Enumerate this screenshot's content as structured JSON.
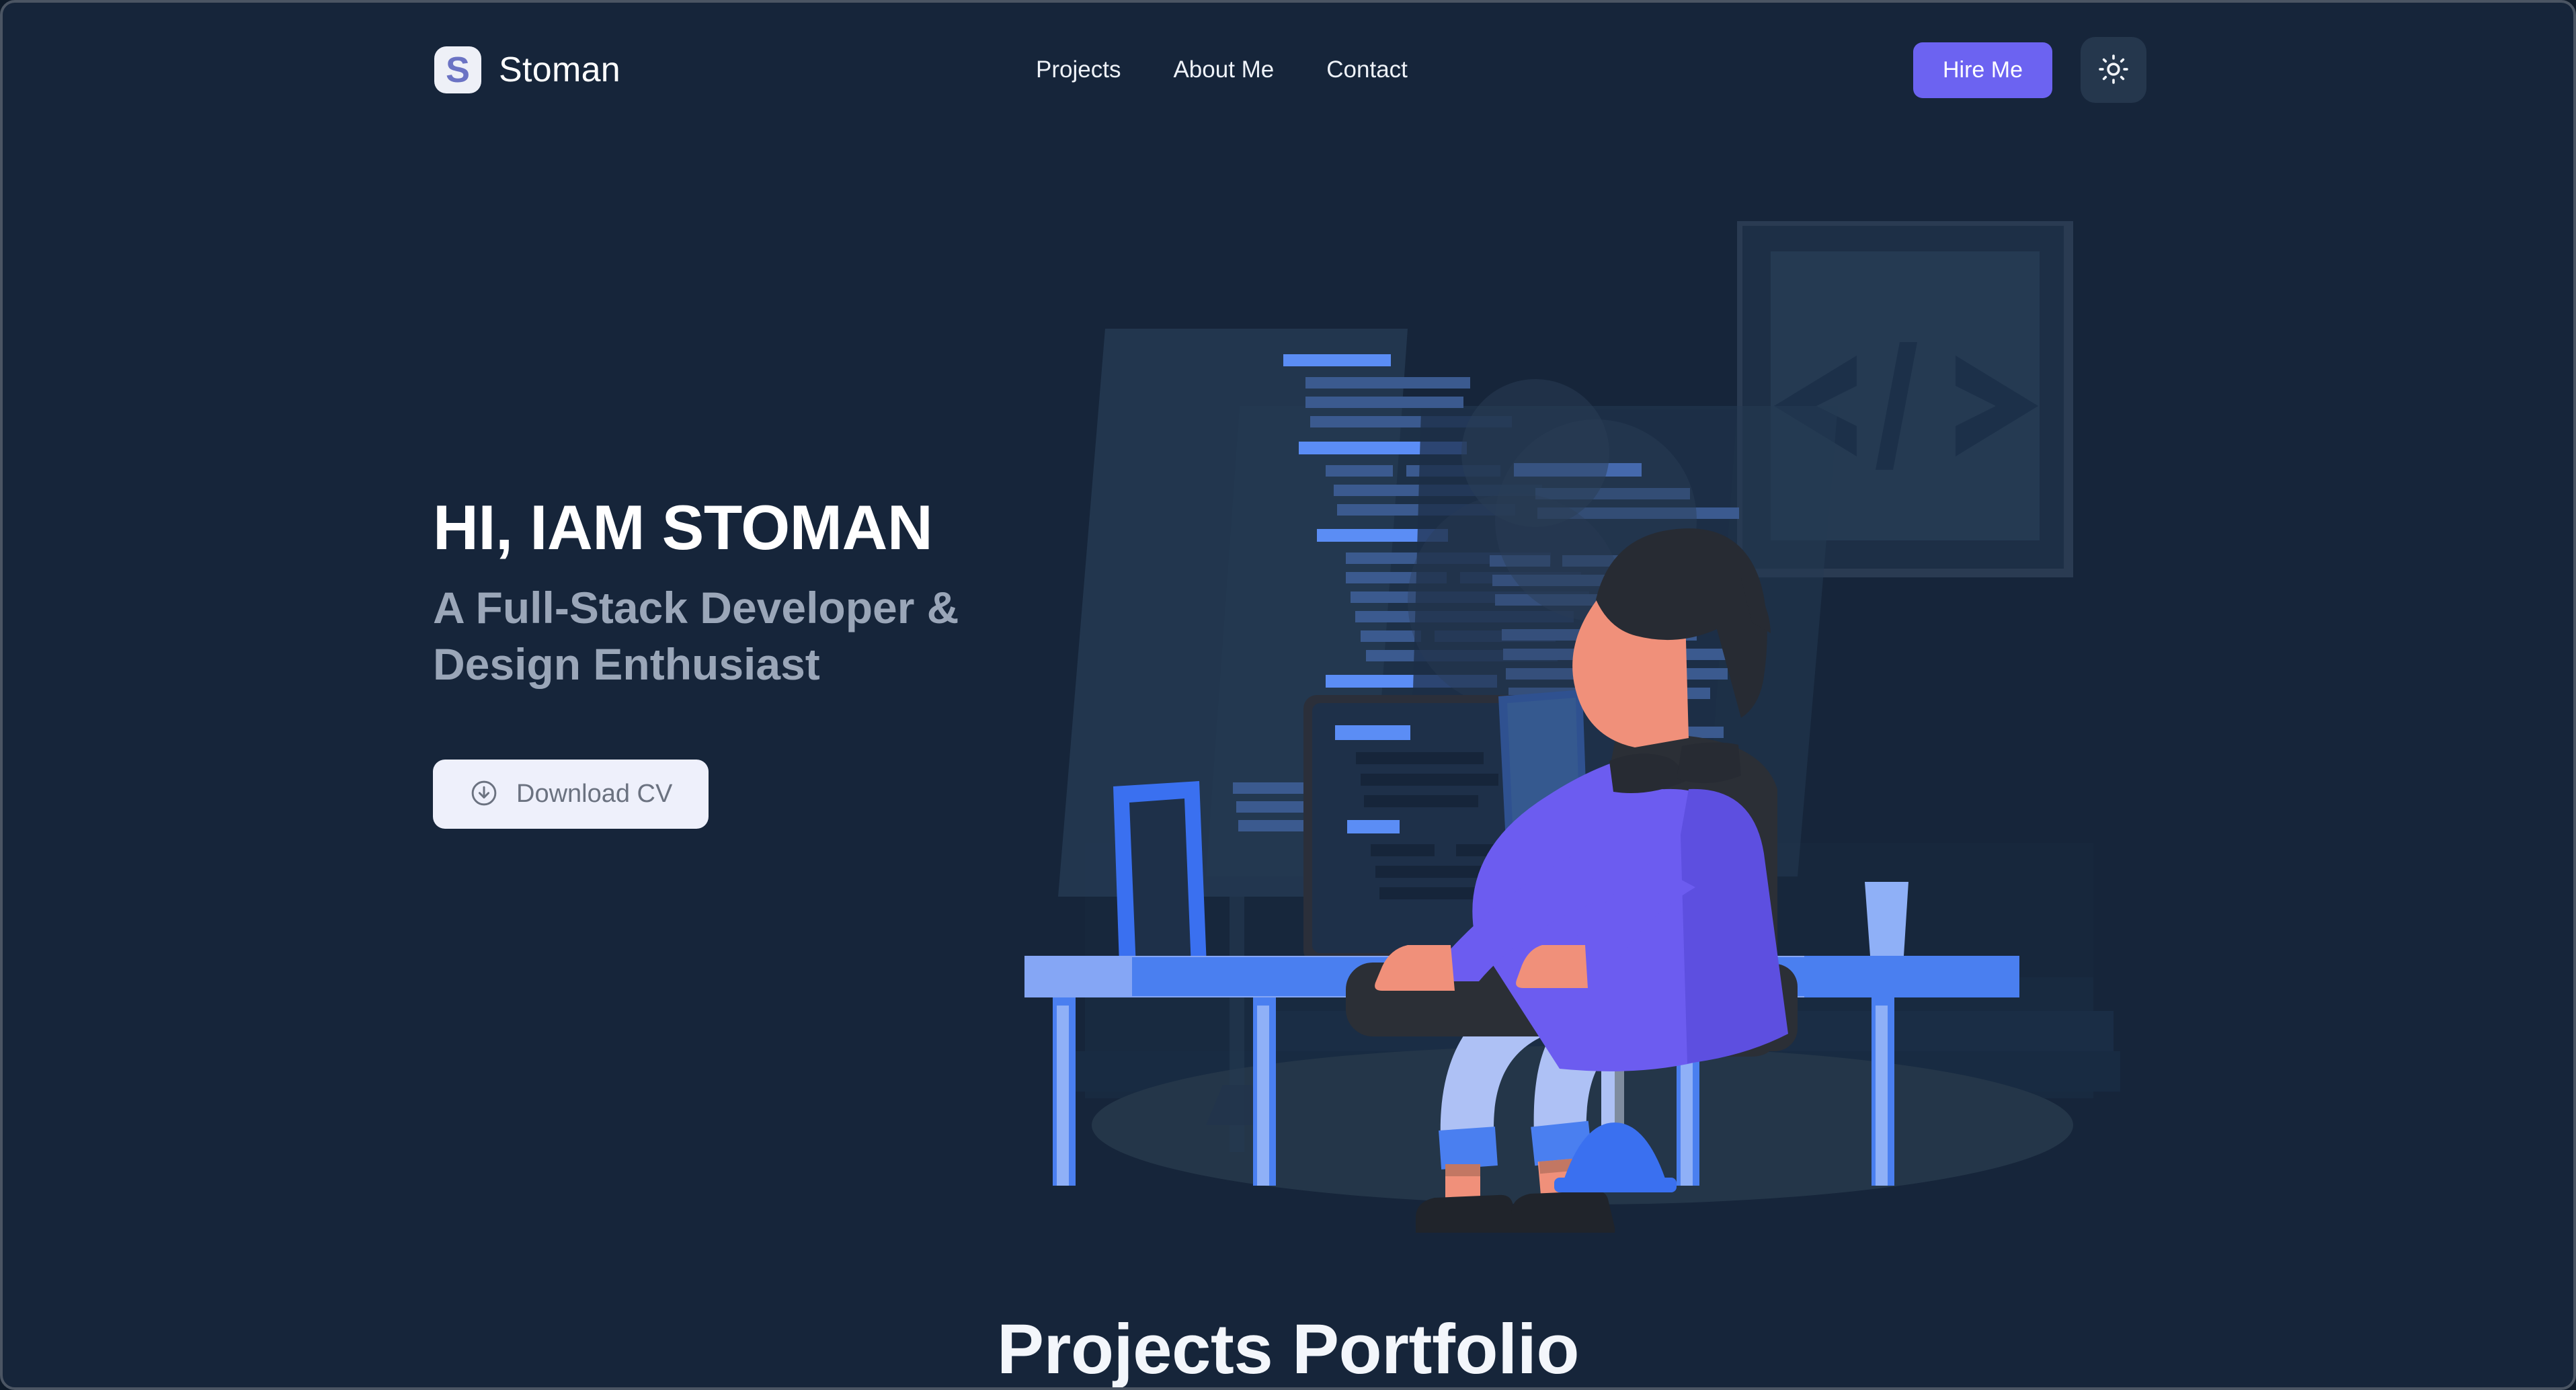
{
  "brand": {
    "name": "Stoman",
    "logo_letter": "S",
    "logo_bg": "#eef0f7",
    "logo_fg": "#6b73c4"
  },
  "nav": {
    "links": [
      {
        "label": "Projects"
      },
      {
        "label": "About Me"
      },
      {
        "label": "Contact"
      }
    ],
    "hire_me_label": "Hire Me",
    "hire_me_color": "#6c63f1",
    "theme_toggle_icon": "sun-icon",
    "theme_toggle_bg": "#25374d"
  },
  "hero": {
    "title": "HI, IAM STOMAN",
    "subtitle": "A Full-Stack Developer & Design Enthusiast",
    "download_cv_label": "Download CV",
    "download_cv_icon": "download-circle-icon",
    "download_cv_bg": "#eef0fb",
    "download_cv_text_color": "#6b7280"
  },
  "illustration": {
    "name": "developer-at-desk-illustration",
    "colors": {
      "background": "#16253a",
      "wall_panel": "#1b2c43",
      "floor_shadow": "#243649",
      "desk_top": "#85a6f5",
      "desk_blue": "#4a7ff0",
      "desk_leg_light": "#8fb0f7",
      "monitor_dark": "#1e3049",
      "monitor_bezel": "#2b2f3a",
      "screen_glow": "#2a3d56",
      "code_line_bright": "#5b8df5",
      "code_line_muted": "#3b5a8f",
      "code_line_dark": "#16253a",
      "shirt_purple": "#6c5cf0",
      "shirt_purple_dark": "#5d4fe0",
      "skin": "#f0907a",
      "skin_shadow": "#c27763",
      "hair": "#272b33",
      "chair": "#2b2f36",
      "jeans": "#aec1f5",
      "jeans_cuff": "#4a7ff0",
      "shoes": "#20242b",
      "frame_symbol": "#1c3049"
    }
  },
  "projects": {
    "heading": "Projects Portfolio"
  }
}
